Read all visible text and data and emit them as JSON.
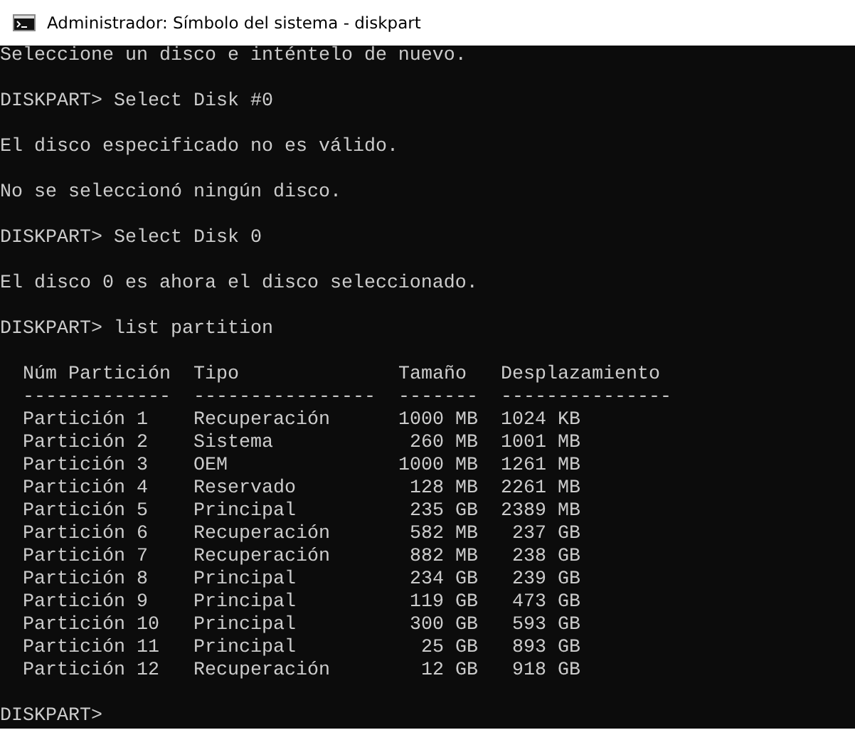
{
  "window": {
    "title": "Administrador: Símbolo del sistema - diskpart"
  },
  "console": {
    "lines": [
      "Seleccione un disco e inténtelo de nuevo.",
      "DISKPART> Select Disk #0",
      "El disco especificado no es válido.",
      "No se seleccionó ningún disco.",
      "DISKPART> Select Disk 0",
      "El disco 0 es ahora el disco seleccionado.",
      "DISKPART> list partition"
    ],
    "table": {
      "columns": [
        "Núm Partición",
        "Tipo",
        "Tamaño",
        "Desplazamiento"
      ],
      "separators": [
        "-------------",
        "----------------",
        "-------",
        "---------------"
      ],
      "rows": [
        [
          "Partición 1",
          "Recuperación",
          "1000 MB",
          "1024 KB"
        ],
        [
          "Partición 2",
          "Sistema",
          "260 MB",
          "1001 MB"
        ],
        [
          "Partición 3",
          "OEM",
          "1000 MB",
          "1261 MB"
        ],
        [
          "Partición 4",
          "Reservado",
          "128 MB",
          "2261 MB"
        ],
        [
          "Partición 5",
          "Principal",
          "235 GB",
          "2389 MB"
        ],
        [
          "Partición 6",
          "Recuperación",
          "582 MB",
          "237 GB"
        ],
        [
          "Partición 7",
          "Recuperación",
          "882 MB",
          "238 GB"
        ],
        [
          "Partición 8",
          "Principal",
          "234 GB",
          "239 GB"
        ],
        [
          "Partición 9",
          "Principal",
          "119 GB",
          "473 GB"
        ],
        [
          "Partición 10",
          "Principal",
          "300 GB",
          "593 GB"
        ],
        [
          "Partición 11",
          "Principal",
          "25 GB",
          "893 GB"
        ],
        [
          "Partición 12",
          "Recuperación",
          "12 GB",
          "918 GB"
        ]
      ]
    },
    "prompt": "DISKPART>"
  }
}
